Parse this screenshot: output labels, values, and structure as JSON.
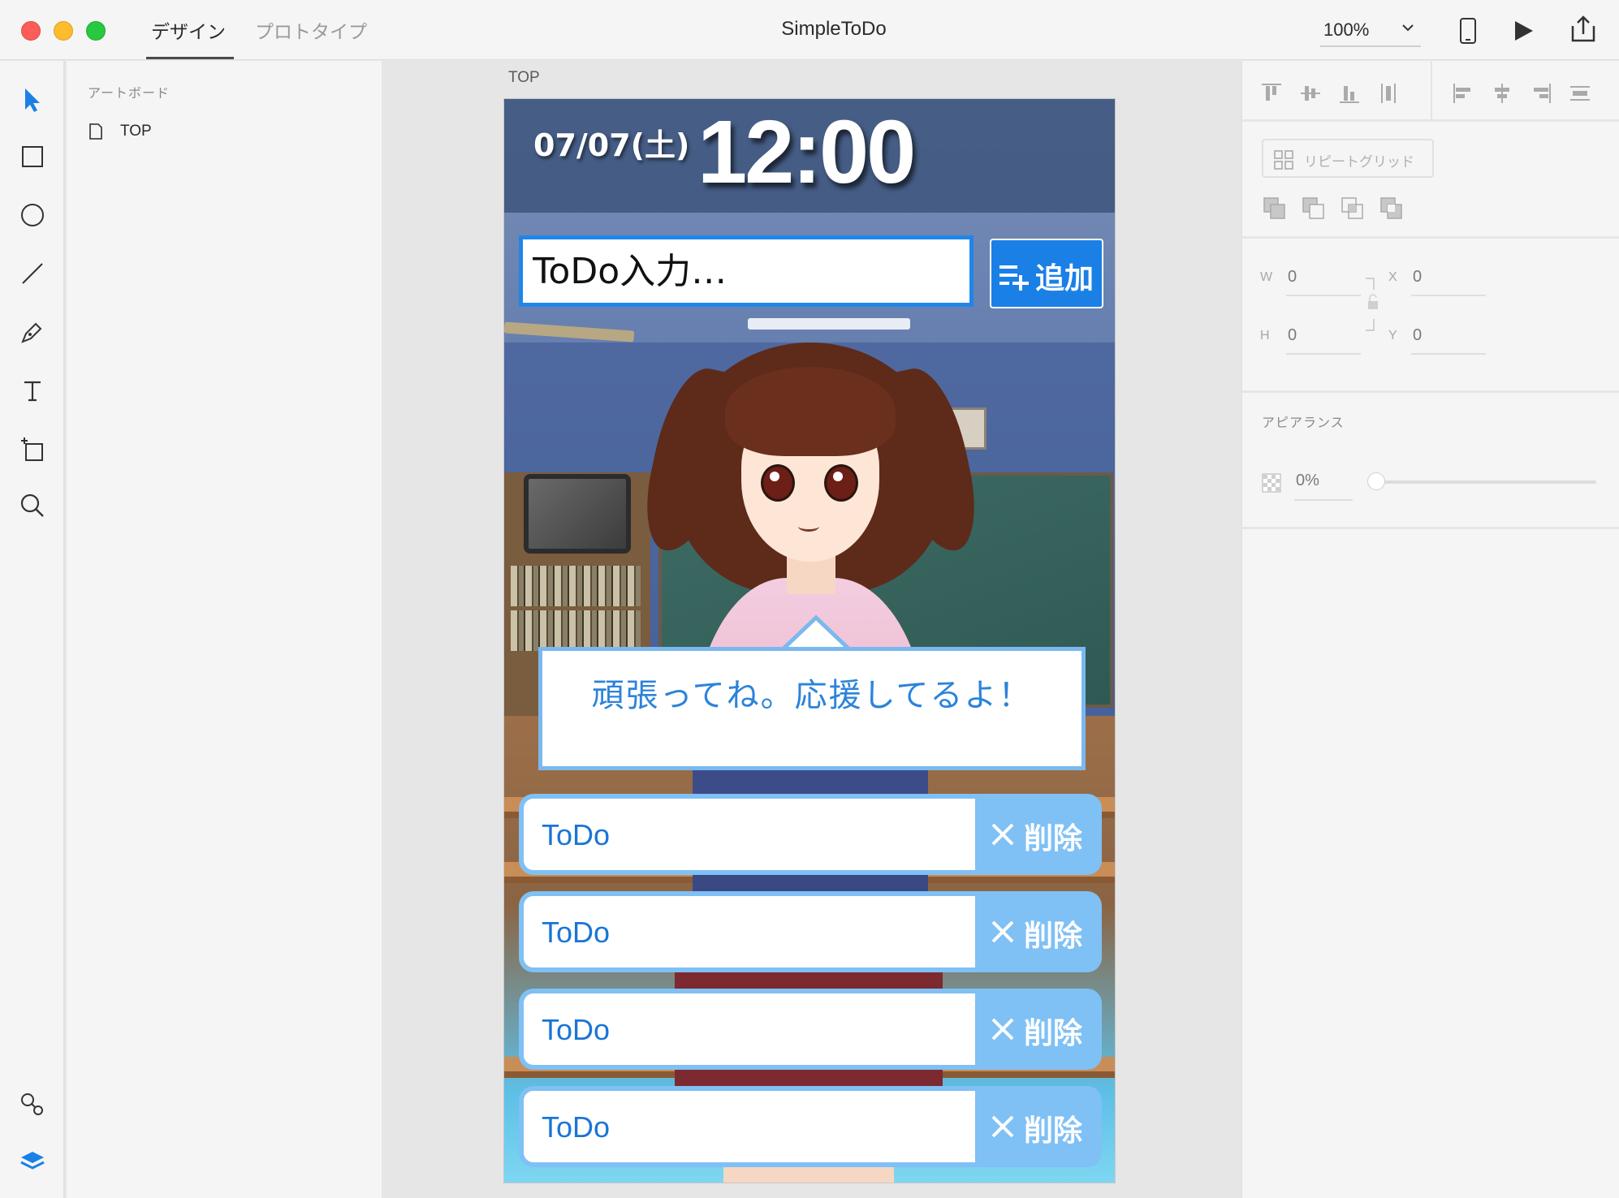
{
  "window": {
    "title": "SimpleToDo",
    "mode_tabs": [
      {
        "label": "デザイン",
        "active": true
      },
      {
        "label": "プロトタイプ",
        "active": false
      }
    ],
    "zoom": "100%"
  },
  "left_toolbar": {
    "tools": [
      "select-icon",
      "rectangle-icon",
      "ellipse-icon",
      "line-icon",
      "pen-icon",
      "text-icon",
      "artboard-icon",
      "zoom-icon",
      "symbols-icon",
      "layers-icon"
    ]
  },
  "layers": {
    "heading": "アートボード",
    "items": [
      {
        "label": "TOP"
      }
    ]
  },
  "canvas": {
    "artboard_label": "TOP"
  },
  "app": {
    "date": "07/07(土)",
    "time": "12:00",
    "input_placeholder": "ToDo入力…",
    "add_button_label": "追加",
    "speech": "頑張ってね。応援してるよ！",
    "todos": [
      {
        "text": "ToDo",
        "delete_label": "削除"
      },
      {
        "text": "ToDo",
        "delete_label": "削除"
      },
      {
        "text": "ToDo",
        "delete_label": "削除"
      },
      {
        "text": "ToDo",
        "delete_label": "削除"
      }
    ],
    "colors": {
      "accent": "#1a80e6",
      "todo_item": "#7fc0f5",
      "todo_text": "#1a75d6",
      "speech_text": "#2c83da"
    }
  },
  "props": {
    "repeat_grid_label": "リピートグリッド",
    "w_label": "W",
    "w_value": "0",
    "h_label": "H",
    "h_value": "0",
    "x_label": "X",
    "x_value": "0",
    "y_label": "Y",
    "y_value": "0",
    "appearance_heading": "アピアランス",
    "opacity": "0%"
  }
}
